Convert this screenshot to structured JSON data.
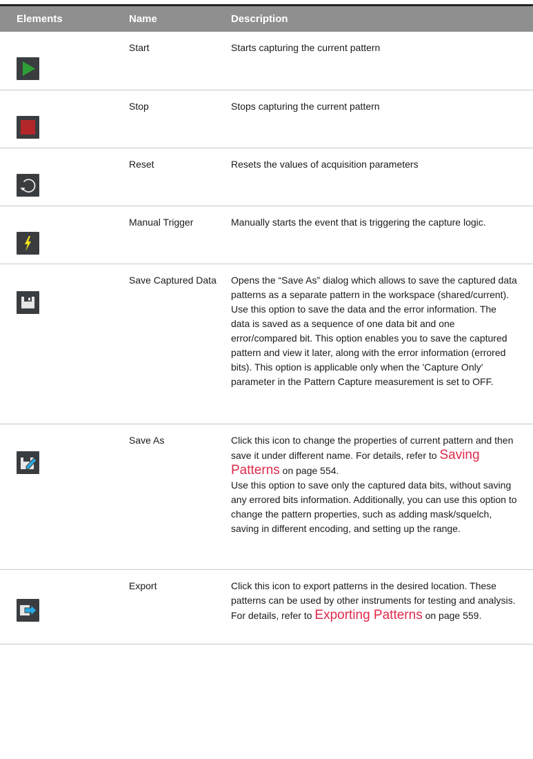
{
  "table": {
    "headers": [
      "Elements",
      "Name",
      "Description"
    ],
    "rows": [
      {
        "icon": "play-icon",
        "name": "Start",
        "description": "Starts capturing the current pattern"
      },
      {
        "icon": "stop-icon",
        "name": "Stop",
        "description": "Stops capturing the current pattern"
      },
      {
        "icon": "reset-icon",
        "name": "Reset",
        "description": "Resets the values of acquisition parameters"
      },
      {
        "icon": "lightning-icon",
        "name": "Manual Trigger",
        "description": "Manually starts the event that is triggering the capture logic."
      },
      {
        "icon": "save-icon",
        "name": "Save Captured Data",
        "description_1": "Opens the “Save As” dialog which allows to save the captured data patterns as a separate pattern in the workspace (shared/current).",
        "description_2": "Use this option to save the data and the error information. The data is saved as a sequence of one data bit and one error/compared bit. This option enables you to save the captured pattern and view it later, along with the error information (errored bits). This option is applicable only when the 'Capture Only' parameter in the Pattern Capture measurement is set to OFF."
      },
      {
        "icon": "save-as-icon",
        "name": "Save As",
        "description_pre": "Click this icon to change the properties of current pattern and then save it under different name. For details, refer to ",
        "link": "Saving Patterns",
        "description_post": " on page 554.",
        "description_2": "Use this option to save only the captured data bits, without saving any errored bits information. Additionally, you can use this option to change the pattern properties, such as adding mask/squelch, saving in different encoding, and setting up the range."
      },
      {
        "icon": "export-icon",
        "name": "Export",
        "description_pre": "Click this icon to export patterns in the desired location. These patterns can be used by other instruments for testing and analysis. For details, refer to ",
        "link": "Exporting Patterns",
        "description_post": " on page 559."
      }
    ]
  },
  "colors": {
    "header_bg": "#8f8f8f",
    "link": "#e0294a",
    "play": "#2e9e36",
    "stop": "#b3262a",
    "lightning": "#f5e51b",
    "export_arrow": "#2aa8e0"
  }
}
